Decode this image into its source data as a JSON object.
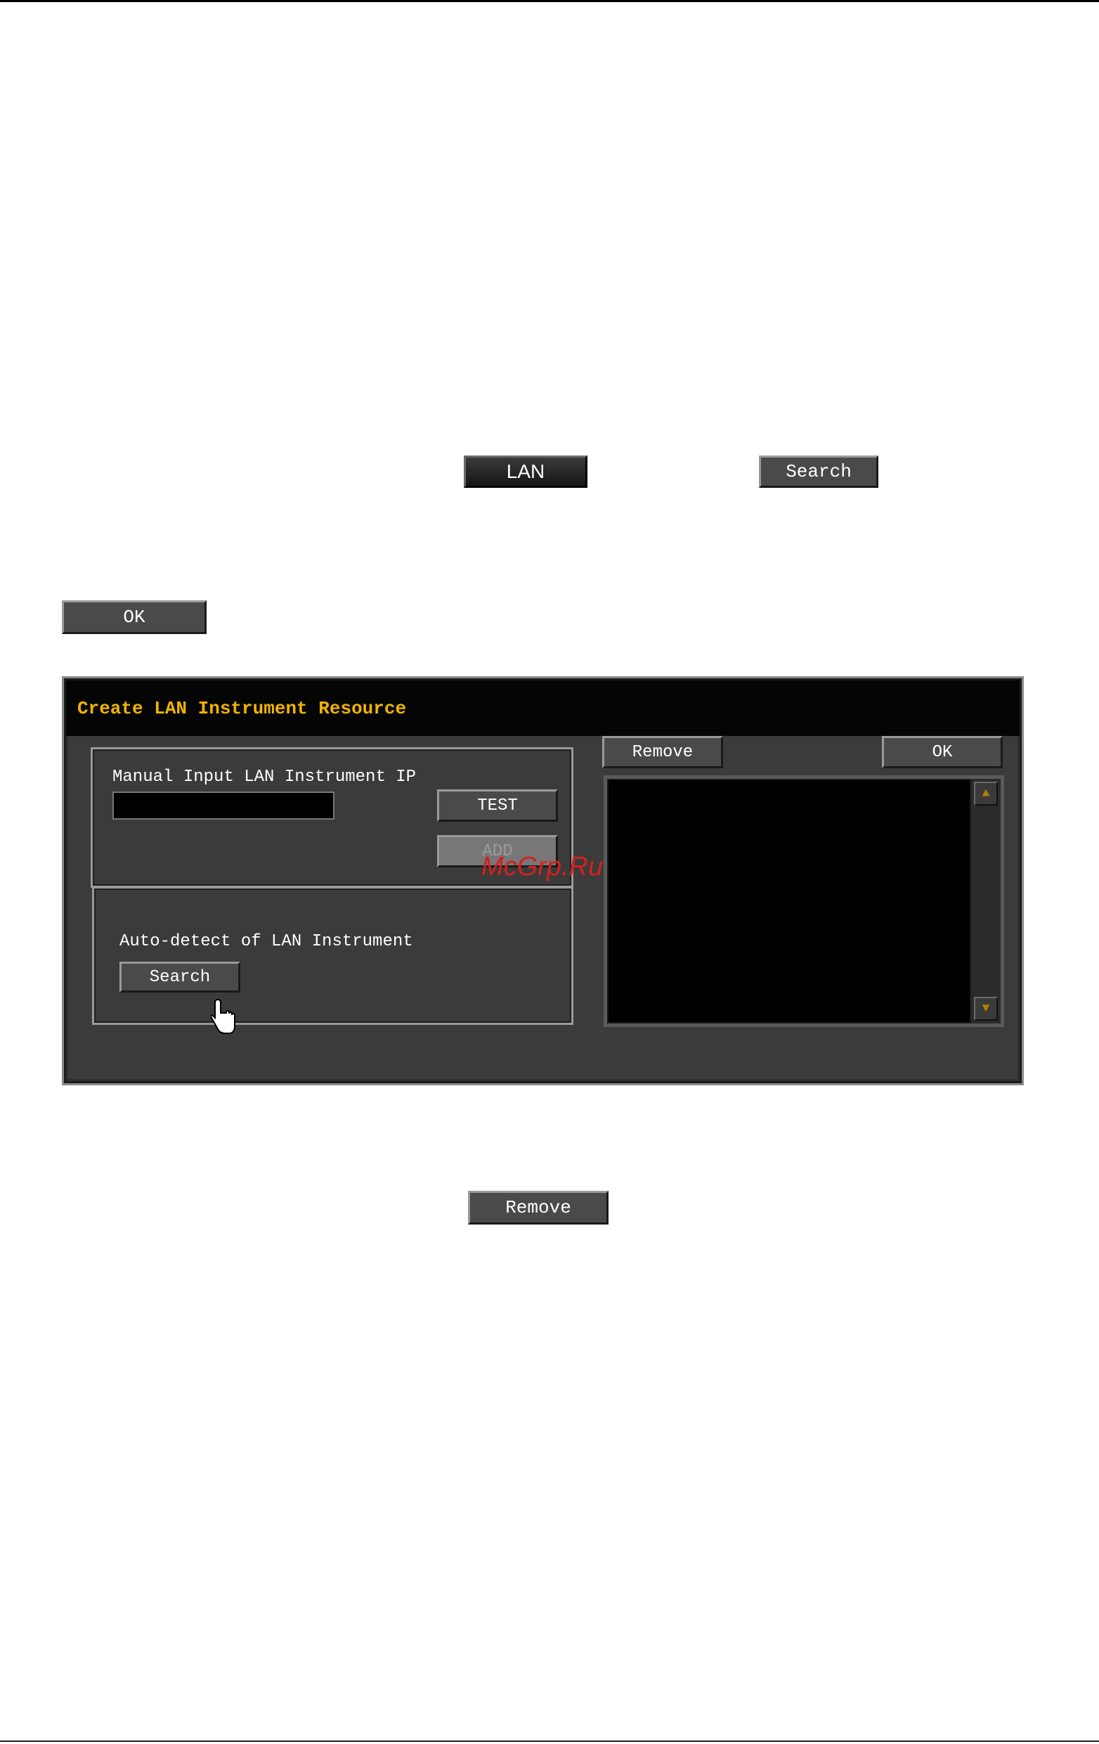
{
  "page": {
    "lan_button_label": "LAN",
    "search_button_label": "Search",
    "ok_button_label": "OK",
    "remove_button_label": "Remove"
  },
  "dialog": {
    "title": "Create LAN Instrument Resource",
    "remove_label": "Remove",
    "ok_label": "OK",
    "manual_label": "Manual Input LAN Instrument IP",
    "ip_value": "",
    "test_label": "TEST",
    "add_label": "ADD",
    "auto_detect_label": "Auto-detect of LAN Instrument",
    "search_label": "Search",
    "instrument_list": []
  },
  "watermark": "McGrp.Ru",
  "colors": {
    "title": "#f0b400",
    "dialog_bg": "#3b3b3b",
    "button_bg": "#4a4a4a"
  }
}
